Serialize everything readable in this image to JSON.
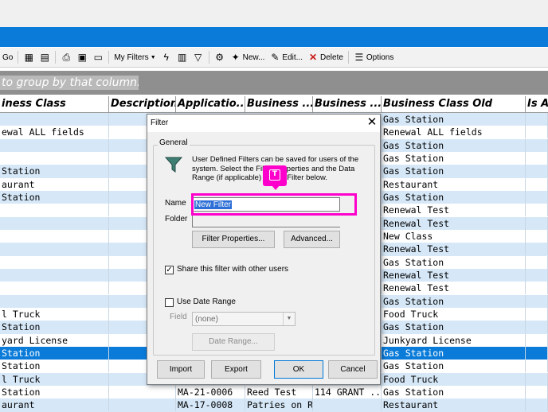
{
  "toolbar": {
    "go_label": "Go",
    "my_filters_label": "My Filters",
    "new_label": "New...",
    "edit_label": "Edit...",
    "delete_label": "Delete",
    "options_label": "Options"
  },
  "group_hint": "to group by that column.",
  "grid": {
    "columns": [
      "iness Class",
      "Description",
      "Applicatio...",
      "Business ...",
      "Business ...",
      "Business Class Old",
      "Is A"
    ],
    "rows": [
      {
        "c0": "",
        "c2": "",
        "c3": "",
        "c4": "",
        "c5": "Gas Station"
      },
      {
        "c0": "ewal ALL fields",
        "c2": "",
        "c3": "",
        "c4": "",
        "c5": "Renewal ALL fields"
      },
      {
        "c0": "",
        "c2": "",
        "c3": "",
        "c4": "",
        "c5": "Gas Station"
      },
      {
        "c0": "",
        "c2": "",
        "c3": "",
        "c4": "",
        "c5": "Gas Station"
      },
      {
        "c0": "Station",
        "c2": "",
        "c3": "",
        "c4": "",
        "c5": "Gas Station"
      },
      {
        "c0": "aurant",
        "c2": "",
        "c3": "",
        "c4": "",
        "c5": "Restaurant"
      },
      {
        "c0": "Station",
        "c2": "",
        "c3": "",
        "c4": "",
        "c5": "Gas Station"
      },
      {
        "c0": "",
        "c2": "",
        "c3": "",
        "c4": "",
        "c5": "Renewal Test"
      },
      {
        "c0": "",
        "c2": "",
        "c3": "",
        "c4": "",
        "c5": "Renewal Test"
      },
      {
        "c0": "",
        "c2": "",
        "c3": "",
        "c4": "",
        "c5": "New Class"
      },
      {
        "c0": "",
        "c2": "",
        "c3": "",
        "c4": "",
        "c5": "Renewal Test"
      },
      {
        "c0": "",
        "c2": "",
        "c3": "",
        "c4": "",
        "c5": "Gas Station"
      },
      {
        "c0": "",
        "c2": "",
        "c3": "",
        "c4": "",
        "c5": "Renewal Test"
      },
      {
        "c0": "",
        "c2": "",
        "c3": "",
        "c4": "",
        "c5": "Renewal Test"
      },
      {
        "c0": "",
        "c2": "",
        "c3": "",
        "c4": "",
        "c5": "Gas Station"
      },
      {
        "c0": "l Truck",
        "c2": "",
        "c3": "",
        "c4": "",
        "c5": "Food Truck"
      },
      {
        "c0": "Station",
        "c2": "",
        "c3": "",
        "c4": "",
        "c5": "Gas Station"
      },
      {
        "c0": "yard License",
        "c2": "",
        "c3": "",
        "c4": "",
        "c5": "Junkyard License"
      },
      {
        "c0": "Station",
        "c2": "",
        "c3": "",
        "c4": "",
        "c5": "Gas Station",
        "selected": true
      },
      {
        "c0": "Station",
        "c2": "",
        "c3": "",
        "c4": "",
        "c5": "Gas Station"
      },
      {
        "c0": "l Truck",
        "c2": "",
        "c3": "",
        "c4": "",
        "c5": "Food Truck"
      },
      {
        "c0": "Station",
        "c2": "MA-21-0006",
        "c3": "Reed Test",
        "c4": "114 GRANT ...",
        "c5": "Gas Station"
      },
      {
        "c0": "aurant",
        "c2": "MA-17-0008",
        "c3": "Patries on R...",
        "c4": "",
        "c5": "Restaurant"
      }
    ]
  },
  "dialog": {
    "title": "Filter",
    "group_label": "General",
    "description": "User Defined Filters can be saved for users of the system. Select the Filter Properties and the Data Range (if applicable) for the Filter below.",
    "name_label": "Name",
    "name_value": "New Filter",
    "folder_label": "Folder",
    "filter_properties_label": "Filter Properties...",
    "advanced_label": "Advanced...",
    "share_label": "Share this filter with other users",
    "share_checked": true,
    "use_date_range_label": "Use Date Range",
    "field_label": "Field",
    "field_value": "(none)",
    "date_range_label": "Date Range...",
    "import_label": "Import",
    "export_label": "Export",
    "ok_label": "OK",
    "cancel_label": "Cancel"
  },
  "highlight_tag": "T",
  "colors": {
    "accent_blue": "#0a7bd9",
    "row_alt": "#d6e8f8",
    "highlight": "#ff00cc"
  }
}
